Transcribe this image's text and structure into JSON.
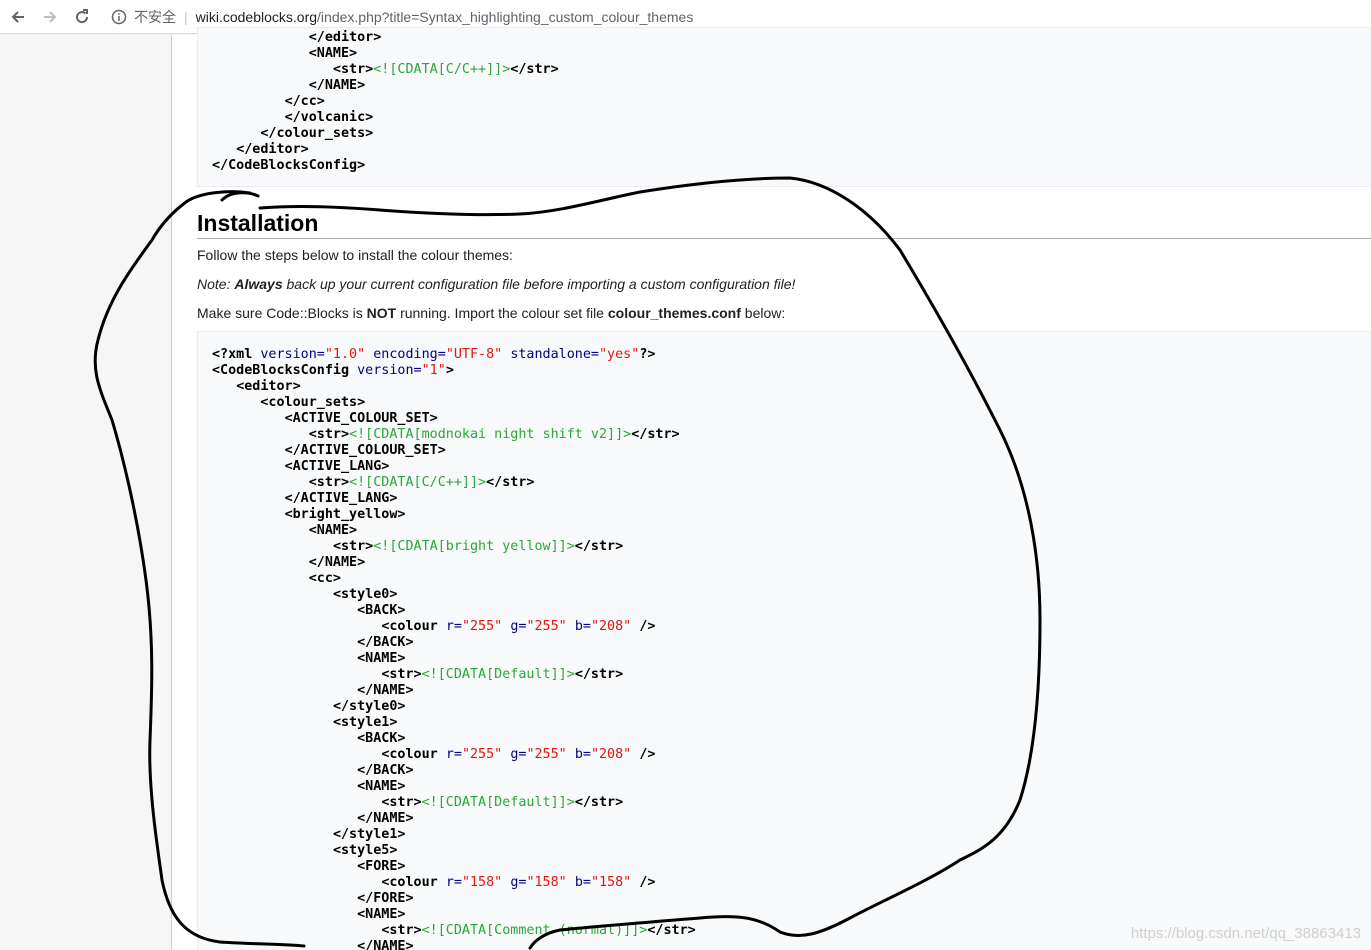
{
  "browser": {
    "security_label": "不安全",
    "separator": "|",
    "url_host": "wiki.codeblocks.org",
    "url_path": "/index.php?title=Syntax_highlighting_custom_colour_themes"
  },
  "code_top": [
    [
      {
        "k": "p",
        "v": "            "
      },
      {
        "k": "t",
        "v": "</editor>"
      }
    ],
    [
      {
        "k": "p",
        "v": "            "
      },
      {
        "k": "t",
        "v": "<NAME>"
      }
    ],
    [
      {
        "k": "p",
        "v": "               "
      },
      {
        "k": "t",
        "v": "<str>"
      },
      {
        "k": "c",
        "v": "<![CDATA[C/C++]]>"
      },
      {
        "k": "t",
        "v": "</str>"
      }
    ],
    [
      {
        "k": "p",
        "v": "            "
      },
      {
        "k": "t",
        "v": "</NAME>"
      }
    ],
    [
      {
        "k": "p",
        "v": "         "
      },
      {
        "k": "t",
        "v": "</cc>"
      }
    ],
    [
      {
        "k": "p",
        "v": "         "
      },
      {
        "k": "t",
        "v": "</volcanic>"
      }
    ],
    [
      {
        "k": "p",
        "v": "      "
      },
      {
        "k": "t",
        "v": "</colour_sets>"
      }
    ],
    [
      {
        "k": "p",
        "v": "   "
      },
      {
        "k": "t",
        "v": "</editor>"
      }
    ],
    [
      {
        "k": "t",
        "v": "</CodeBlocksConfig>"
      }
    ]
  ],
  "section": {
    "heading": "Installation",
    "intro": "Follow the steps below to install the colour themes:",
    "note_prefix": "Note: ",
    "note_strong": "Always",
    "note_rest": " back up your current configuration file before importing a custom configuration file!",
    "step_a": "Make sure Code::Blocks is ",
    "step_not": "NOT",
    "step_b": " running. Import the colour set file ",
    "step_file": "colour_themes.conf",
    "step_c": " below:"
  },
  "code_main": [
    [
      {
        "k": "t",
        "v": "<?xml "
      },
      {
        "k": "a",
        "v": "version="
      },
      {
        "k": "s",
        "v": "\"1.0\""
      },
      {
        "k": "p",
        "v": " "
      },
      {
        "k": "a",
        "v": "encoding="
      },
      {
        "k": "s",
        "v": "\"UTF-8\""
      },
      {
        "k": "p",
        "v": " "
      },
      {
        "k": "a",
        "v": "standalone="
      },
      {
        "k": "s",
        "v": "\"yes\""
      },
      {
        "k": "t",
        "v": "?>"
      }
    ],
    [
      {
        "k": "t",
        "v": "<CodeBlocksConfig "
      },
      {
        "k": "a",
        "v": "version="
      },
      {
        "k": "s",
        "v": "\"1\""
      },
      {
        "k": "t",
        "v": ">"
      }
    ],
    [
      {
        "k": "p",
        "v": "   "
      },
      {
        "k": "t",
        "v": "<editor>"
      }
    ],
    [
      {
        "k": "p",
        "v": "      "
      },
      {
        "k": "t",
        "v": "<colour_sets>"
      }
    ],
    [
      {
        "k": "p",
        "v": "         "
      },
      {
        "k": "t",
        "v": "<ACTIVE_COLOUR_SET>"
      }
    ],
    [
      {
        "k": "p",
        "v": "            "
      },
      {
        "k": "t",
        "v": "<str>"
      },
      {
        "k": "c",
        "v": "<![CDATA[modnokai night shift v2]]>"
      },
      {
        "k": "t",
        "v": "</str>"
      }
    ],
    [
      {
        "k": "p",
        "v": "         "
      },
      {
        "k": "t",
        "v": "</ACTIVE_COLOUR_SET>"
      }
    ],
    [
      {
        "k": "p",
        "v": "         "
      },
      {
        "k": "t",
        "v": "<ACTIVE_LANG>"
      }
    ],
    [
      {
        "k": "p",
        "v": "            "
      },
      {
        "k": "t",
        "v": "<str>"
      },
      {
        "k": "c",
        "v": "<![CDATA[C/C++]]>"
      },
      {
        "k": "t",
        "v": "</str>"
      }
    ],
    [
      {
        "k": "p",
        "v": "         "
      },
      {
        "k": "t",
        "v": "</ACTIVE_LANG>"
      }
    ],
    [
      {
        "k": "p",
        "v": "         "
      },
      {
        "k": "t",
        "v": "<bright_yellow>"
      }
    ],
    [
      {
        "k": "p",
        "v": "            "
      },
      {
        "k": "t",
        "v": "<NAME>"
      }
    ],
    [
      {
        "k": "p",
        "v": "               "
      },
      {
        "k": "t",
        "v": "<str>"
      },
      {
        "k": "c",
        "v": "<![CDATA[bright yellow]]>"
      },
      {
        "k": "t",
        "v": "</str>"
      }
    ],
    [
      {
        "k": "p",
        "v": "            "
      },
      {
        "k": "t",
        "v": "</NAME>"
      }
    ],
    [
      {
        "k": "p",
        "v": "            "
      },
      {
        "k": "t",
        "v": "<cc>"
      }
    ],
    [
      {
        "k": "p",
        "v": "               "
      },
      {
        "k": "t",
        "v": "<style0>"
      }
    ],
    [
      {
        "k": "p",
        "v": "                  "
      },
      {
        "k": "t",
        "v": "<BACK>"
      }
    ],
    [
      {
        "k": "p",
        "v": "                     "
      },
      {
        "k": "t",
        "v": "<colour "
      },
      {
        "k": "a",
        "v": "r="
      },
      {
        "k": "s",
        "v": "\"255\""
      },
      {
        "k": "p",
        "v": " "
      },
      {
        "k": "a",
        "v": "g="
      },
      {
        "k": "s",
        "v": "\"255\""
      },
      {
        "k": "p",
        "v": " "
      },
      {
        "k": "a",
        "v": "b="
      },
      {
        "k": "s",
        "v": "\"208\""
      },
      {
        "k": "p",
        "v": " "
      },
      {
        "k": "t",
        "v": "/>"
      }
    ],
    [
      {
        "k": "p",
        "v": "                  "
      },
      {
        "k": "t",
        "v": "</BACK>"
      }
    ],
    [
      {
        "k": "p",
        "v": "                  "
      },
      {
        "k": "t",
        "v": "<NAME>"
      }
    ],
    [
      {
        "k": "p",
        "v": "                     "
      },
      {
        "k": "t",
        "v": "<str>"
      },
      {
        "k": "c",
        "v": "<![CDATA[Default]]>"
      },
      {
        "k": "t",
        "v": "</str>"
      }
    ],
    [
      {
        "k": "p",
        "v": "                  "
      },
      {
        "k": "t",
        "v": "</NAME>"
      }
    ],
    [
      {
        "k": "p",
        "v": "               "
      },
      {
        "k": "t",
        "v": "</style0>"
      }
    ],
    [
      {
        "k": "p",
        "v": "               "
      },
      {
        "k": "t",
        "v": "<style1>"
      }
    ],
    [
      {
        "k": "p",
        "v": "                  "
      },
      {
        "k": "t",
        "v": "<BACK>"
      }
    ],
    [
      {
        "k": "p",
        "v": "                     "
      },
      {
        "k": "t",
        "v": "<colour "
      },
      {
        "k": "a",
        "v": "r="
      },
      {
        "k": "s",
        "v": "\"255\""
      },
      {
        "k": "p",
        "v": " "
      },
      {
        "k": "a",
        "v": "g="
      },
      {
        "k": "s",
        "v": "\"255\""
      },
      {
        "k": "p",
        "v": " "
      },
      {
        "k": "a",
        "v": "b="
      },
      {
        "k": "s",
        "v": "\"208\""
      },
      {
        "k": "p",
        "v": " "
      },
      {
        "k": "t",
        "v": "/>"
      }
    ],
    [
      {
        "k": "p",
        "v": "                  "
      },
      {
        "k": "t",
        "v": "</BACK>"
      }
    ],
    [
      {
        "k": "p",
        "v": "                  "
      },
      {
        "k": "t",
        "v": "<NAME>"
      }
    ],
    [
      {
        "k": "p",
        "v": "                     "
      },
      {
        "k": "t",
        "v": "<str>"
      },
      {
        "k": "c",
        "v": "<![CDATA[Default]]>"
      },
      {
        "k": "t",
        "v": "</str>"
      }
    ],
    [
      {
        "k": "p",
        "v": "                  "
      },
      {
        "k": "t",
        "v": "</NAME>"
      }
    ],
    [
      {
        "k": "p",
        "v": "               "
      },
      {
        "k": "t",
        "v": "</style1>"
      }
    ],
    [
      {
        "k": "p",
        "v": "               "
      },
      {
        "k": "t",
        "v": "<style5>"
      }
    ],
    [
      {
        "k": "p",
        "v": "                  "
      },
      {
        "k": "t",
        "v": "<FORE>"
      }
    ],
    [
      {
        "k": "p",
        "v": "                     "
      },
      {
        "k": "t",
        "v": "<colour "
      },
      {
        "k": "a",
        "v": "r="
      },
      {
        "k": "s",
        "v": "\"158\""
      },
      {
        "k": "p",
        "v": " "
      },
      {
        "k": "a",
        "v": "g="
      },
      {
        "k": "s",
        "v": "\"158\""
      },
      {
        "k": "p",
        "v": " "
      },
      {
        "k": "a",
        "v": "b="
      },
      {
        "k": "s",
        "v": "\"158\""
      },
      {
        "k": "p",
        "v": " "
      },
      {
        "k": "t",
        "v": "/>"
      }
    ],
    [
      {
        "k": "p",
        "v": "                  "
      },
      {
        "k": "t",
        "v": "</FORE>"
      }
    ],
    [
      {
        "k": "p",
        "v": "                  "
      },
      {
        "k": "t",
        "v": "<NAME>"
      }
    ],
    [
      {
        "k": "p",
        "v": "                     "
      },
      {
        "k": "t",
        "v": "<str>"
      },
      {
        "k": "c",
        "v": "<![CDATA[Comment (normal)]]>"
      },
      {
        "k": "t",
        "v": "</str>"
      }
    ],
    [
      {
        "k": "p",
        "v": "                  "
      },
      {
        "k": "t",
        "v": "</NAME>"
      }
    ]
  ],
  "watermark": "https://blog.csdn.net/qq_38863413",
  "colors": {
    "tag": "#000000",
    "attr": "#000080",
    "string": "#e3160f",
    "cdata": "#2aa63a",
    "annotation": "#000000"
  }
}
